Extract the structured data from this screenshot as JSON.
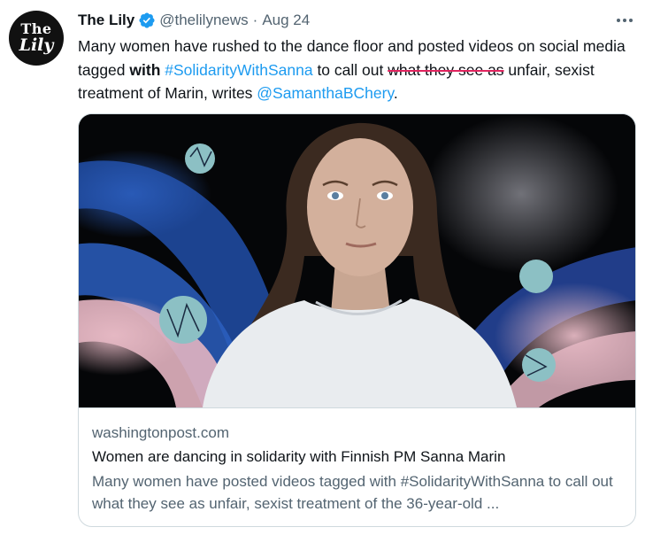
{
  "author": {
    "avatar_line1": "The",
    "avatar_line2": "Lily",
    "name": "The Lily",
    "handle": "@thelilynews",
    "separator": "·",
    "date": "Aug 24"
  },
  "icons": {
    "verified": "verified-badge-icon",
    "more": "more-horizontal-icon"
  },
  "colors": {
    "link": "#1d9bf0",
    "strikethrough": "#e0245e",
    "secondary_text": "#536471"
  },
  "tweet": {
    "text_part1": "Many women have rushed to the dance floor and posted videos on social media tagged ",
    "bold_word": "with",
    "space1": " ",
    "hashtag": "#SolidarityWithSanna",
    "text_part2": " to call out ",
    "struck_text": "what they see as",
    "text_part3": " unfair, sexist treatment of Marin, writes ",
    "mention": "@SamanthaBChery",
    "text_end": "."
  },
  "card": {
    "domain": "washingtonpost.com",
    "title": "Women are dancing in solidarity with Finnish PM Sanna Marin",
    "description": "Many women have posted videos tagged with #SolidarityWithSanna to call out what they see as unfair, sexist treatment of the 36-year-old ..."
  }
}
